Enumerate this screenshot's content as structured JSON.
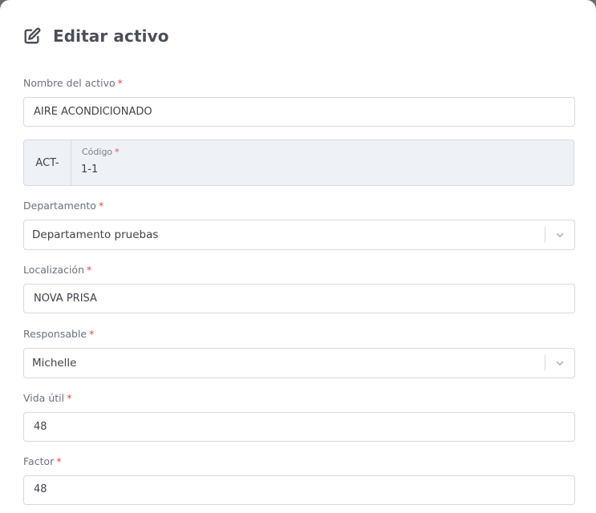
{
  "modal": {
    "title": "Editar activo",
    "title_icon": "edit-icon"
  },
  "fields": {
    "nombre": {
      "label": "Nombre del activo",
      "required": "*",
      "value": "AIRE ACONDICIONADO"
    },
    "codigo": {
      "prefix": "ACT-",
      "label": "Código",
      "required": "*",
      "value": "1-1"
    },
    "departamento": {
      "label": "Departamento",
      "required": "*",
      "value": "Departamento pruebas"
    },
    "localizacion": {
      "label": "Localización",
      "required": "*",
      "value": "NOVA PRISA"
    },
    "responsable": {
      "label": "Responsable",
      "required": "*",
      "value": "Michelle"
    },
    "vida_util": {
      "label": "Vida útil",
      "required": "*",
      "value": "48"
    },
    "factor": {
      "label": "Factor",
      "required": "*",
      "value": "48"
    }
  },
  "colors": {
    "required": "#e5484d",
    "border": "#d6d9de",
    "prefix_bg": "#eef1f6"
  }
}
